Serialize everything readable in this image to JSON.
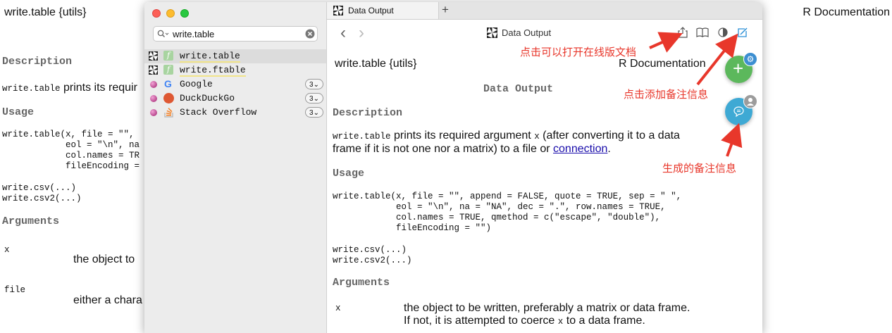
{
  "background_doc": {
    "title": "write.table {utils}",
    "r_documentation": "R Documentation",
    "description_heading": "Description",
    "description_code": "write.table",
    "description_text": "prints its requir",
    "usage_heading": "Usage",
    "usage_code": "write.table(x, file = \"\",\n            eol = \"\\n\", na\n            col.names = TR\n            fileEncoding =",
    "usage_code2": "write.csv(...)\nwrite.csv2(...)",
    "arguments_heading": "Arguments",
    "arg1_name": "x",
    "arg1_text": "the object to",
    "arg2_name": "file",
    "arg2_text": "either a chara"
  },
  "sidebar": {
    "search_value": "write.table",
    "results": [
      {
        "label": "write.table",
        "type": "function",
        "selected": true
      },
      {
        "label": "write.ftable",
        "type": "function",
        "selected": false
      },
      {
        "label": "Google",
        "type": "web",
        "badge": "3"
      },
      {
        "label": "DuckDuckGo",
        "type": "web",
        "badge": "3"
      },
      {
        "label": "Stack Overflow",
        "type": "web",
        "badge": "3"
      }
    ]
  },
  "tab": {
    "label": "Data Output",
    "new_tab": "+"
  },
  "toolbar": {
    "title": "Data Output",
    "back": "‹",
    "forward": "›"
  },
  "doc": {
    "title": "write.table {utils}",
    "r_documentation": "R Documentation",
    "heading": "Data Output",
    "description_heading": "Description",
    "desc_code": "write.table",
    "desc_text1": "prints its required argument",
    "desc_x": "x",
    "desc_text2": "(after converting it to a data",
    "desc_text3": "frame if it is not one nor a matrix) to a file or",
    "desc_link": "connection",
    "desc_end": ".",
    "usage_heading": "Usage",
    "usage_code": "write.table(x, file = \"\", append = FALSE, quote = TRUE, sep = \" \",\n            eol = \"\\n\", na = \"NA\", dec = \".\", row.names = TRUE,\n            col.names = TRUE, qmethod = c(\"escape\", \"double\"),\n            fileEncoding = \"\")",
    "usage_code2": "write.csv(...)\nwrite.csv2(...)",
    "arguments_heading": "Arguments",
    "arg1_name": "x",
    "arg1_text1": "the object to be written, preferably a matrix or data frame.",
    "arg1_text2a": "If not, it is attempted to coerce",
    "arg1_x": "x",
    "arg1_text2b": "to a data frame."
  },
  "annotations": {
    "open_online": "点击可以打开在线版文档",
    "add_note": "点击添加备注信息",
    "generated_note": "生成的备注信息"
  },
  "colors": {
    "annotation_red": "#e8372b",
    "fab_green": "#5cb85c",
    "fab_blue": "#3ea9d4",
    "link": "#1a0dab"
  }
}
